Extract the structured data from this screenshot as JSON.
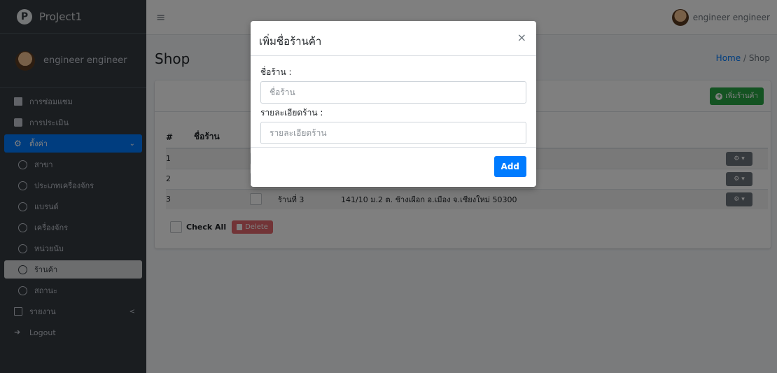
{
  "brand": {
    "title": "ProJect1",
    "logo_letter": "P"
  },
  "user": {
    "name": "engineer engineer"
  },
  "topbar": {
    "menu_glyph": "≡",
    "user_name": "engineer engineer"
  },
  "sidebar": {
    "items": [
      {
        "label": "การซ่อมแซม"
      },
      {
        "label": "การประเมิน"
      },
      {
        "label": "ตั้งค่า",
        "chevron": "⌄"
      },
      {
        "label": "สาขา"
      },
      {
        "label": "ประเภทเครื่องจักร"
      },
      {
        "label": "แบรนด์"
      },
      {
        "label": "เครื่องจักร"
      },
      {
        "label": "หน่วยนับ"
      },
      {
        "label": "ร้านค้า"
      },
      {
        "label": "สถานะ"
      },
      {
        "label": "รายงาน",
        "chevron": "<"
      },
      {
        "label": "Logout"
      }
    ]
  },
  "page": {
    "title": "Shop",
    "breadcrumb_home": "Home",
    "breadcrumb_sep": "/",
    "breadcrumb_current": "Shop"
  },
  "card": {
    "add_button": "เพิ่มร้านค้า",
    "columns": [
      "#",
      "ชื่อร้าน"
    ],
    "rows": [
      {
        "num": "1",
        "name": "",
        "address": ""
      },
      {
        "num": "2",
        "name": "",
        "address": ""
      },
      {
        "num": "3",
        "name": "ร้านที่ 3",
        "address": "141/10 ม.2 ต. ช้างเผือก อ.เมือง จ.เชียงใหม่ 50300"
      }
    ],
    "check_all": "Check All",
    "delete": "Delete",
    "gear_glyph": "⚙ ▾"
  },
  "modal": {
    "title": "เพิ่มชื่อร้านค้า",
    "close": "×",
    "shop_name_label": "ชื่อร้าน :",
    "shop_name_placeholder": "ชื่อร้าน",
    "shop_detail_label": "รายละเอียดร้าน :",
    "shop_detail_placeholder": "รายละเอียดร้าน",
    "add_button": "Add"
  }
}
